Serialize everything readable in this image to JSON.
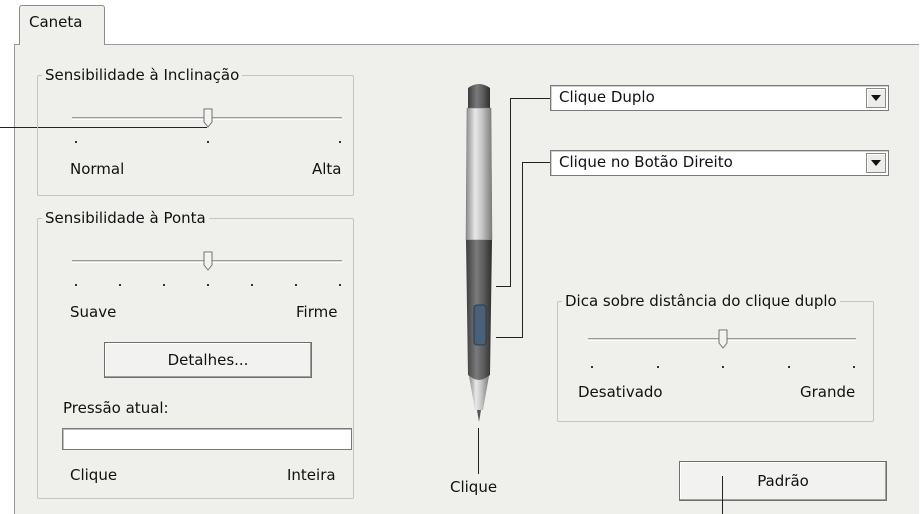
{
  "tab": {
    "label": "Caneta"
  },
  "tilt": {
    "legend": "Sensibilidade à Inclinação",
    "min_label": "Normal",
    "max_label": "Alta",
    "value_fraction": 0.5,
    "tick_count": 3
  },
  "tip": {
    "legend": "Sensibilidade à Ponta",
    "min_label": "Suave",
    "max_label": "Firme",
    "value_fraction": 0.5,
    "tick_count": 7,
    "details_button": "Detalhes...",
    "pressure_label": "Pressão atual:",
    "pressure_min": "Clique",
    "pressure_max": "Inteira"
  },
  "pen": {
    "tip_label": "Clique",
    "upper_button_select": "Clique Duplo",
    "lower_button_select": "Clique no Botão Direito"
  },
  "double_click": {
    "legend": "Dica sobre distância do clique duplo",
    "min_label": "Desativado",
    "max_label": "Grande",
    "value_fraction": 0.5,
    "tick_count": 5
  },
  "default_button": "Padrão",
  "colors": {
    "panel": "#efefec",
    "pen_body": "#b8b8b8",
    "pen_grip": "#5a5a5a"
  }
}
